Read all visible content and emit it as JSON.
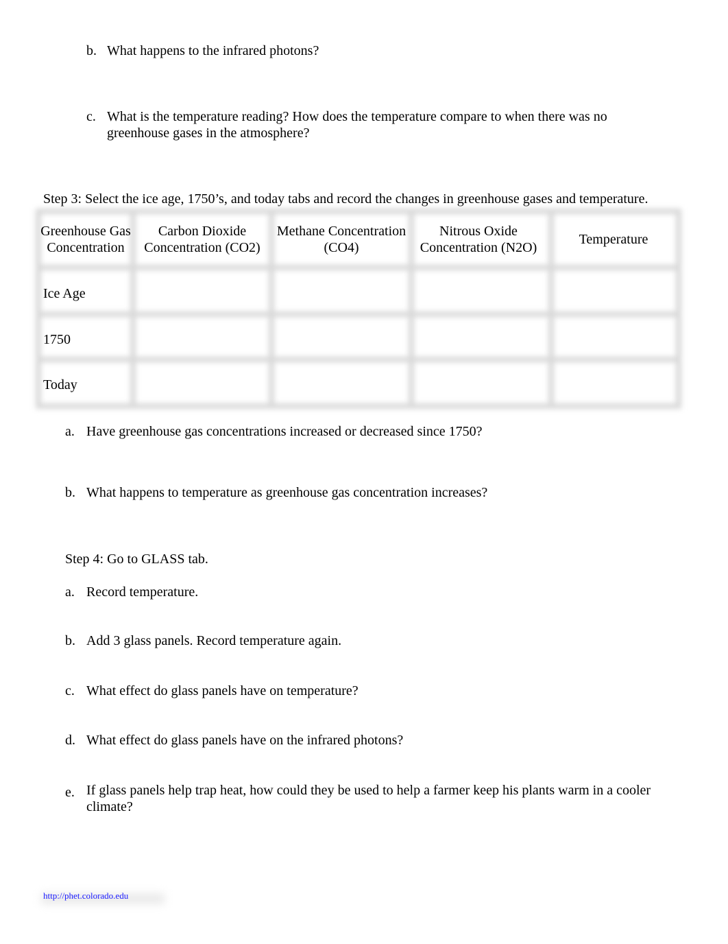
{
  "part2_questions": [
    {
      "marker": "b.",
      "text": "What happens to the infrared photons?"
    },
    {
      "marker": "c.",
      "text": "What is the temperature reading? How does the temperature compare to when there was no greenhouse gases in the atmosphere?"
    }
  ],
  "step3": {
    "instruction": "Step 3: Select the ice age, 1750’s, and today tabs and record the changes in greenhouse gases and temperature.",
    "table": {
      "headers": [
        "Greenhouse Gas Concentration",
        "Carbon Dioxide Concentration (CO2)",
        "Methane Concentration (CO4)",
        "Nitrous Oxide Concentration (N2O)",
        "Temperature"
      ],
      "rows": [
        {
          "label": "Ice Age",
          "cells": [
            "",
            "",
            "",
            ""
          ]
        },
        {
          "label": "1750",
          "cells": [
            "",
            "",
            "",
            ""
          ]
        },
        {
          "label": "Today",
          "cells": [
            "",
            "",
            "",
            ""
          ]
        }
      ]
    },
    "questions": [
      {
        "marker": "a.",
        "text": "Have greenhouse gas concentrations increased or decreased since 1750?"
      },
      {
        "marker": "b.",
        "text": "What happens to temperature as greenhouse gas concentration increases?"
      }
    ]
  },
  "step4": {
    "instruction": "Step 4: Go to GLASS tab.",
    "questions": [
      {
        "marker": "a.",
        "text": "Record temperature."
      },
      {
        "marker": "b.",
        "text": "Add 3 glass panels. Record temperature again."
      },
      {
        "marker": "c.",
        "text": "What effect do glass panels have on temperature?"
      },
      {
        "marker": "d.",
        "text": "What effect do glass panels have on the infrared photons?"
      },
      {
        "marker": "e.",
        "text": "If glass panels help trap heat, how could they be used to help a farmer keep his plants warm in a cooler climate?"
      }
    ]
  },
  "footer": {
    "link_text": "http://phet.colorado.edu",
    "link_color": "#1a1aff"
  }
}
